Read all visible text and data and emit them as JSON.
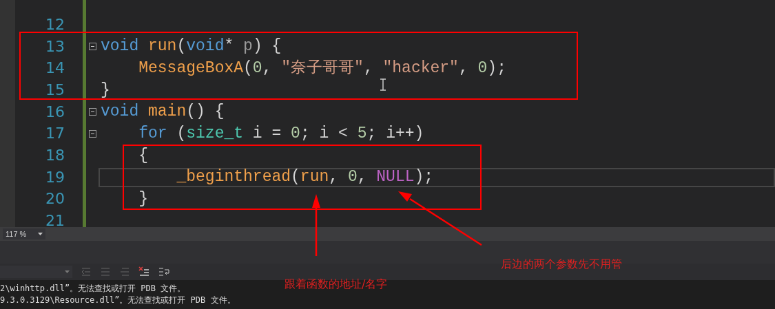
{
  "editor": {
    "lines": [
      {
        "number": "12",
        "fold": false,
        "current": false
      },
      {
        "number": "13",
        "fold": true,
        "current": false,
        "tokens": [
          {
            "text": "void ",
            "kind": "keyword"
          },
          {
            "text": "run",
            "kind": "function"
          },
          {
            "text": "(",
            "kind": "punct"
          },
          {
            "text": "void",
            "kind": "keyword"
          },
          {
            "text": "* ",
            "kind": "punct"
          },
          {
            "text": "p",
            "kind": "param"
          },
          {
            "text": ") {",
            "kind": "punct"
          }
        ]
      },
      {
        "number": "14",
        "fold": false,
        "current": false,
        "tokens": [
          {
            "text": "    MessageBoxA",
            "kind": "function"
          },
          {
            "text": "(",
            "kind": "punct"
          },
          {
            "text": "0",
            "kind": "number"
          },
          {
            "text": ", ",
            "kind": "punct"
          },
          {
            "text": "\"奈子哥哥\"",
            "kind": "string"
          },
          {
            "text": ", ",
            "kind": "punct"
          },
          {
            "text": "\"hacker\"",
            "kind": "string"
          },
          {
            "text": ", ",
            "kind": "punct"
          },
          {
            "text": "0",
            "kind": "number"
          },
          {
            "text": ");",
            "kind": "punct"
          }
        ]
      },
      {
        "number": "15",
        "fold": false,
        "current": false,
        "tokens": [
          {
            "text": "}",
            "kind": "punct"
          }
        ]
      },
      {
        "number": "16",
        "fold": true,
        "current": false,
        "tokens": [
          {
            "text": "void ",
            "kind": "keyword"
          },
          {
            "text": "main",
            "kind": "function"
          },
          {
            "text": "() {",
            "kind": "punct"
          }
        ]
      },
      {
        "number": "17",
        "fold": true,
        "current": false,
        "tokens": [
          {
            "text": "    for",
            "kind": "keyword"
          },
          {
            "text": " (",
            "kind": "punct"
          },
          {
            "text": "size_t",
            "kind": "type"
          },
          {
            "text": " i = ",
            "kind": "punct"
          },
          {
            "text": "0",
            "kind": "number"
          },
          {
            "text": "; i < ",
            "kind": "punct"
          },
          {
            "text": "5",
            "kind": "number"
          },
          {
            "text": "; i++)",
            "kind": "punct"
          }
        ]
      },
      {
        "number": "18",
        "fold": false,
        "current": false,
        "tokens": [
          {
            "text": "    {",
            "kind": "punct"
          }
        ]
      },
      {
        "number": "19",
        "fold": false,
        "current": true,
        "tokens": [
          {
            "text": "        _beginthread",
            "kind": "function"
          },
          {
            "text": "(",
            "kind": "punct"
          },
          {
            "text": "run",
            "kind": "function"
          },
          {
            "text": ", ",
            "kind": "punct"
          },
          {
            "text": "0",
            "kind": "number"
          },
          {
            "text": ", ",
            "kind": "punct"
          },
          {
            "text": "NULL",
            "kind": "macro"
          },
          {
            "text": ");",
            "kind": "punct"
          }
        ]
      },
      {
        "number": "20",
        "fold": false,
        "current": false,
        "tokens": [
          {
            "text": "    }",
            "kind": "punct"
          }
        ]
      },
      {
        "number": "21",
        "fold": false,
        "current": false
      }
    ],
    "zoom": "117 %"
  },
  "output": {
    "lines": [
      "2\\winhttp.dll”。无法查找或打开 PDB 文件。",
      "9.3.0.3129\\Resource.dll”。无法查找或打开 PDB 文件。"
    ]
  },
  "annotations": [
    {
      "kind": "below",
      "text": "跟着函数的地址/名字"
    },
    {
      "kind": "right",
      "text": "后边的两个参数先不用管"
    }
  ]
}
